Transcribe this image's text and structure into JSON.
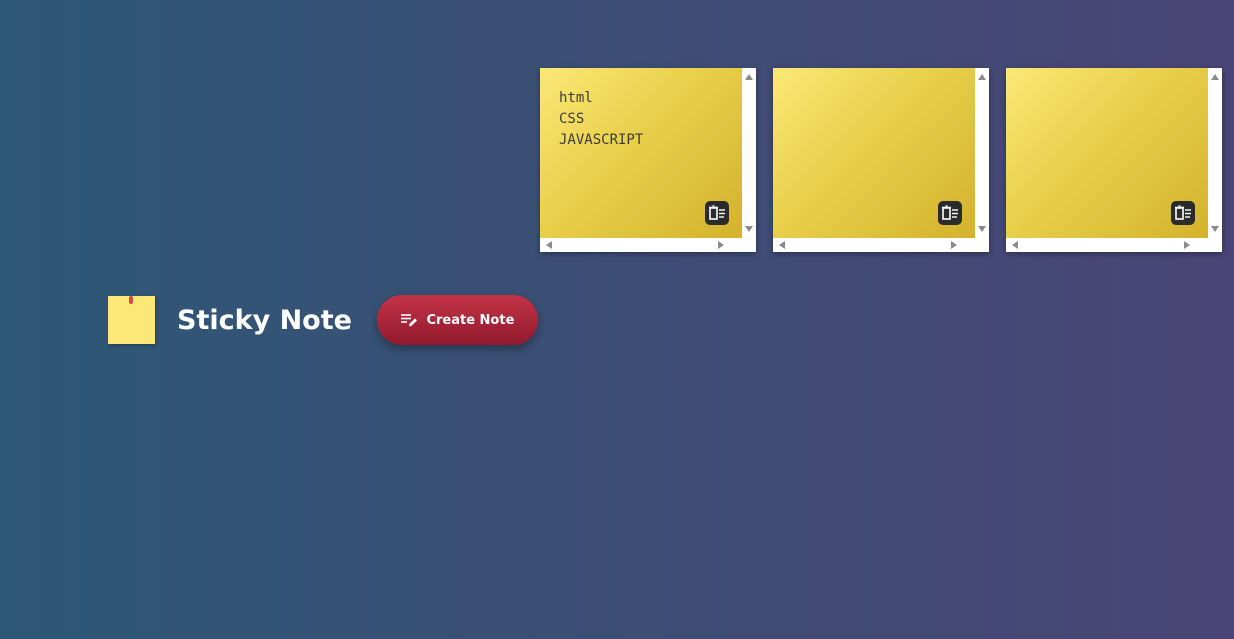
{
  "app": {
    "title": "Sticky Note",
    "logo_icon": "sticky-note-icon",
    "create_button": {
      "label": "Create Note",
      "icon": "edit-list-icon"
    }
  },
  "notes": [
    {
      "content": "html\nCSS\nJAVASCRIPT",
      "delete_icon": "delete-note-icon"
    },
    {
      "content": "",
      "delete_icon": "delete-note-icon"
    },
    {
      "content": "",
      "delete_icon": "delete-note-icon"
    }
  ],
  "colors": {
    "note_yellow": "#fbe876",
    "note_gold": "#d4b22c",
    "button_red": "#c63347",
    "button_dark_red": "#8f1a2c",
    "background_left": "#2d5876",
    "background_right": "#4a4576"
  }
}
